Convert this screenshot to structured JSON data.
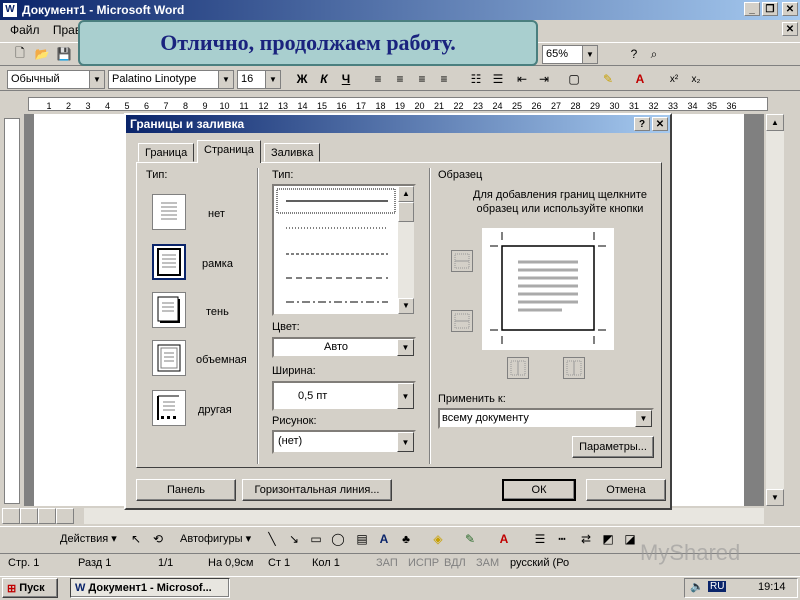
{
  "window": {
    "title": "Документ1 - Microsoft Word"
  },
  "menu": [
    "Файл",
    "Правка"
  ],
  "toolbar": {
    "zoom": "65%"
  },
  "format_bar": {
    "style": "Обычный",
    "font": "Palatino Linotype",
    "size": "16",
    "bold": "Ж",
    "italic": "К",
    "underline": "Ч"
  },
  "banner": {
    "text": "Отлично, продолжаем работу."
  },
  "dialog": {
    "title": "Границы и заливка",
    "tabs": [
      "Граница",
      "Страница",
      "Заливка"
    ],
    "type_label": "Тип:",
    "settings": [
      "нет",
      "рамка",
      "тень",
      "объемная",
      "другая"
    ],
    "style_label": "Тип:",
    "color_label": "Цвет:",
    "color_value": "Авто",
    "width_label": "Ширина:",
    "width_value": "0,5 пт",
    "art_label": "Рисунок:",
    "art_value": "(нет)",
    "preview_label": "Образец",
    "preview_hint": "Для добавления границ щелкните образец или используйте кнопки",
    "apply_label": "Применить к:",
    "apply_value": "всему документу",
    "options_btn": "Параметры...",
    "toolbar_btn": "Панель",
    "hline_btn": "Горизонтальная линия...",
    "ok_btn": "ОК",
    "cancel_btn": "Отмена"
  },
  "drawing_bar": {
    "actions": "Действия",
    "autoshapes": "Автофигуры"
  },
  "status": {
    "page": "Стр. 1",
    "section": "Разд 1",
    "pages": "1/1",
    "at": "На 0,9см",
    "line": "Ст 1",
    "col": "Кол 1",
    "rec": "ЗАП",
    "trk": "ИСПР",
    "ext": "ВДЛ",
    "ovr": "ЗАМ",
    "lang": "русский (Ро"
  },
  "taskbar": {
    "start": "Пуск",
    "task": "Документ1 - Microsof...",
    "lang": "RU",
    "time": "19:14"
  },
  "watermark": "MyShared",
  "colors": {
    "titlebar": "#0a246a",
    "banner_bg": "#a9cfcf",
    "banner_text": "#1a237e"
  }
}
